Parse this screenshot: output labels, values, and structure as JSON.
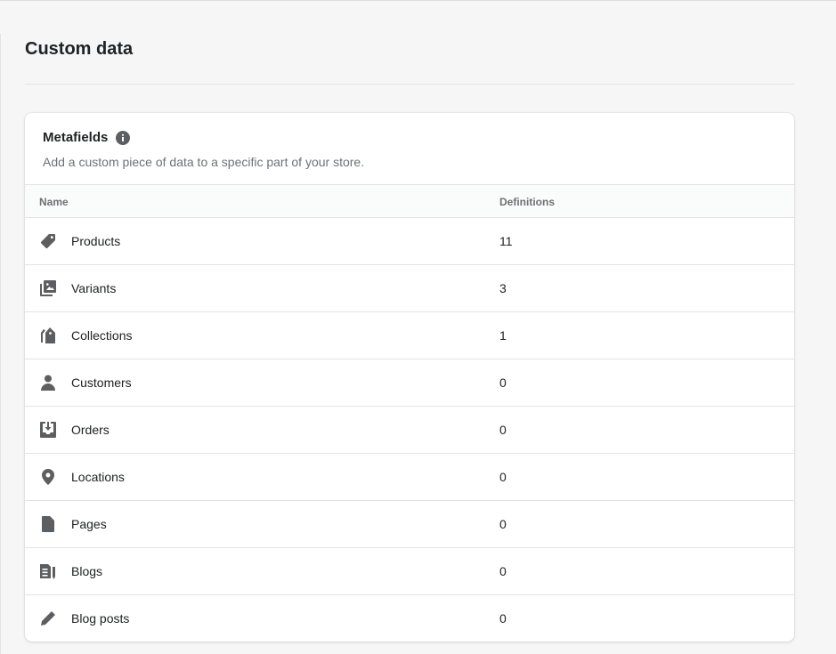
{
  "page": {
    "title": "Custom data"
  },
  "card": {
    "title": "Metafields",
    "subtitle": "Add a custom piece of data to a specific part of your store.",
    "info_icon": "info-icon"
  },
  "table": {
    "columns": [
      "Name",
      "Definitions"
    ],
    "rows": [
      {
        "icon": "tag-icon",
        "name": "Products",
        "definitions": "11"
      },
      {
        "icon": "variants-icon",
        "name": "Variants",
        "definitions": "3"
      },
      {
        "icon": "collections-icon",
        "name": "Collections",
        "definitions": "1"
      },
      {
        "icon": "person-icon",
        "name": "Customers",
        "definitions": "0"
      },
      {
        "icon": "orders-icon",
        "name": "Orders",
        "definitions": "0"
      },
      {
        "icon": "location-pin-icon",
        "name": "Locations",
        "definitions": "0"
      },
      {
        "icon": "page-icon",
        "name": "Pages",
        "definitions": "0"
      },
      {
        "icon": "blog-icon",
        "name": "Blogs",
        "definitions": "0"
      },
      {
        "icon": "pencil-icon",
        "name": "Blog posts",
        "definitions": "0"
      }
    ]
  },
  "colors": {
    "background": "#f6f6f7",
    "card": "#ffffff",
    "icon": "#5c5f62",
    "text": "#202223",
    "subdued_text": "#6d7175",
    "border": "#e1e3e5"
  }
}
